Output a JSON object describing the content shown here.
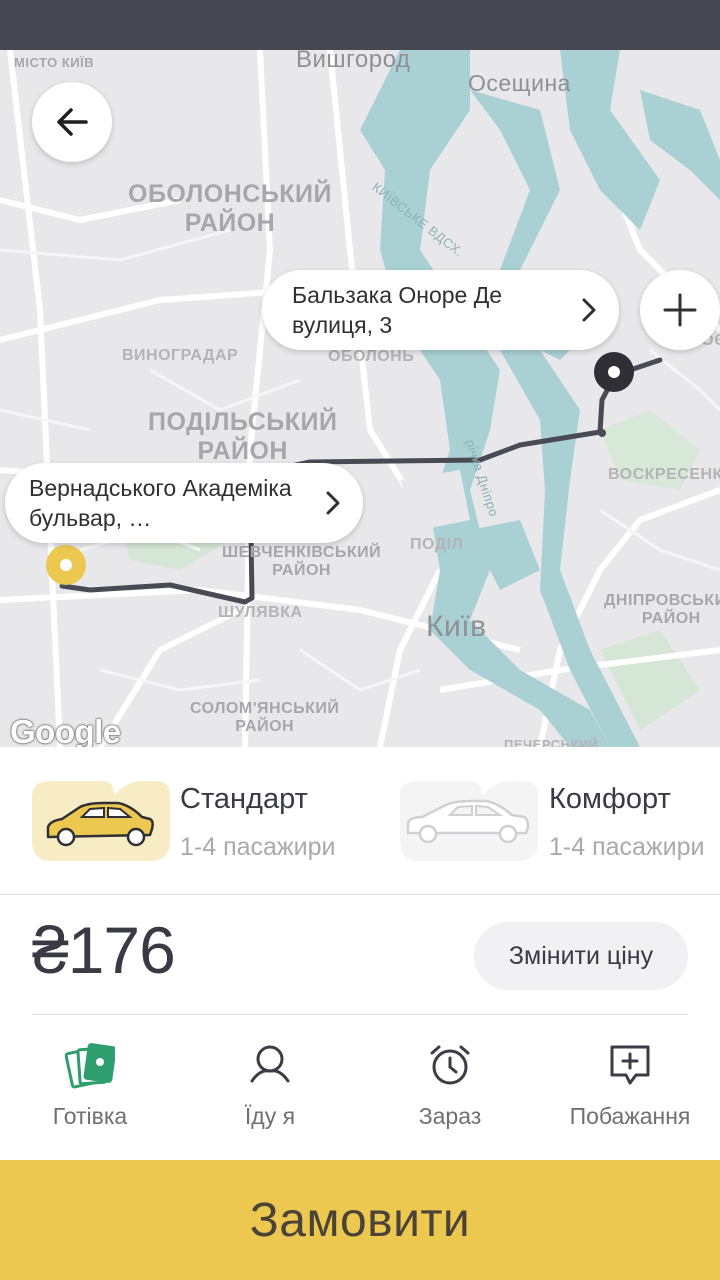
{
  "map": {
    "labels": {
      "misto_kyiv": "МІСТО КИЇВ",
      "vyshhorod": "Вишгород",
      "oseshchyna": "Осещина",
      "obolonskyi_1": "ОБОЛОНСЬКИЙ",
      "obolonskyi_2": "РАЙОН",
      "kyivske_vdskh": "КИЇВСЬКЕ ВДСХ.",
      "vynohradar": "ВИНОГРАДАР",
      "obolon": "ОБОЛОНЬ",
      "podilskyi_1": "ПОДІЛЬСЬКИЙ",
      "podilskyi_2": "РАЙОН",
      "troieshchyna": "ТРОЄЩИНА",
      "voskresenka": "ВОСКРЕСЕНКА",
      "richka_dnipro": "річка Дніпро",
      "podil": "ПОДІЛ",
      "shevchenkivskyi_1": "ШЕВЧЕНКІВСЬКИЙ",
      "shevchenkivskyi_2": "РАЙОН",
      "shuliavka": "ШУЛЯВКА",
      "kyiv": "Київ",
      "dniprovskyi_1": "ДНІПРОВСЬКИЙ",
      "dniprovskyi_2": "РАЙОН",
      "solomianskyi_1": "СОЛОМ'ЯНСЬКИЙ",
      "solomianskyi_2": "РАЙОН",
      "pecherskyi": "ПЕЧЕРСЬКИЙ"
    },
    "google": "Google",
    "destination": "Бальзака Оноре Де вулиця, 3",
    "origin": "Вернадського Академіка бульвар, …"
  },
  "tariffs": [
    {
      "name": "Стандарт",
      "subtitle": "1-4 пасажири",
      "selected": true
    },
    {
      "name": "Комфорт",
      "subtitle": "1-4 пасажири",
      "selected": false
    }
  ],
  "price": "₴176",
  "change_price": "Змінити ціну",
  "options": [
    {
      "label": "Готівка",
      "icon": "cash-icon"
    },
    {
      "label": "Їду я",
      "icon": "person-icon"
    },
    {
      "label": "Зараз",
      "icon": "alarm-clock-icon"
    },
    {
      "label": "Побажання",
      "icon": "comment-add-icon"
    }
  ],
  "order_button": "Замовити",
  "colors": {
    "accent": "#ECC850",
    "status_bar": "#474752",
    "route": "#4A4A55",
    "water": "#A9D0D3",
    "origin_marker": "#ECC850",
    "cash_icon": "#2E9E6E"
  }
}
